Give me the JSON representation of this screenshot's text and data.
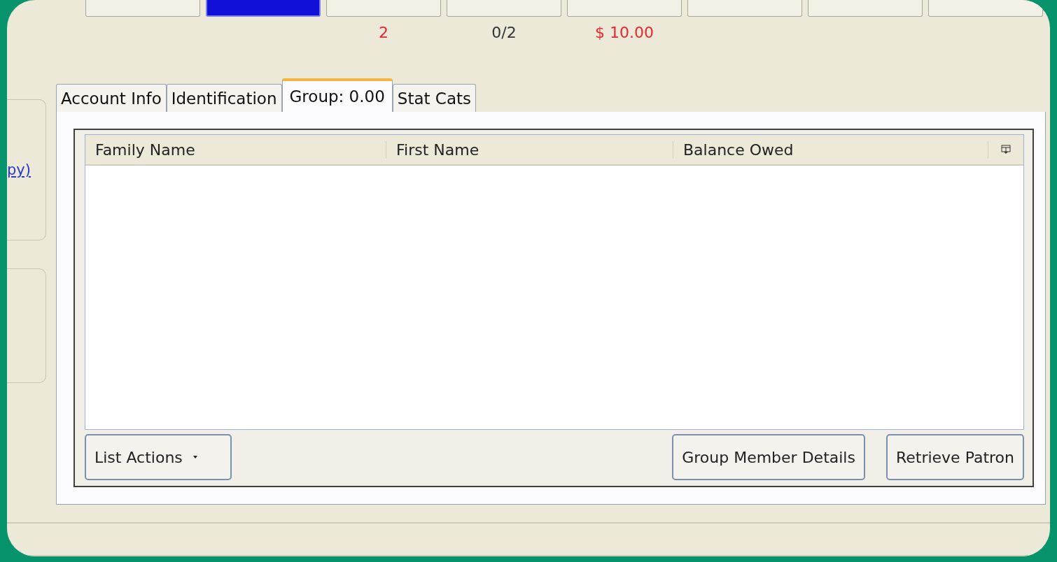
{
  "toolbar_buttons": [
    {
      "selected": false
    },
    {
      "selected": true
    },
    {
      "selected": false,
      "count": "2",
      "alert": true
    },
    {
      "selected": false,
      "count": "0/2",
      "alert": false
    },
    {
      "selected": false,
      "count": "$ 10.00",
      "alert": true
    },
    {
      "selected": false
    },
    {
      "selected": false
    },
    {
      "selected": false
    }
  ],
  "side_link": "py)",
  "tabs": [
    {
      "label": "Account Info",
      "selected": false
    },
    {
      "label": "Identification",
      "selected": false
    },
    {
      "label": "Group: 0.00",
      "selected": true
    },
    {
      "label": "Stat Cats",
      "selected": false
    }
  ],
  "table": {
    "columns": [
      "Family Name",
      "First Name",
      "Balance Owed"
    ]
  },
  "buttons": [
    {
      "label": "List Actions",
      "kind": "menu"
    },
    {
      "label": "Group Member Details",
      "kind": "plain"
    },
    {
      "label": "Retrieve Patron",
      "kind": "plain"
    }
  ]
}
